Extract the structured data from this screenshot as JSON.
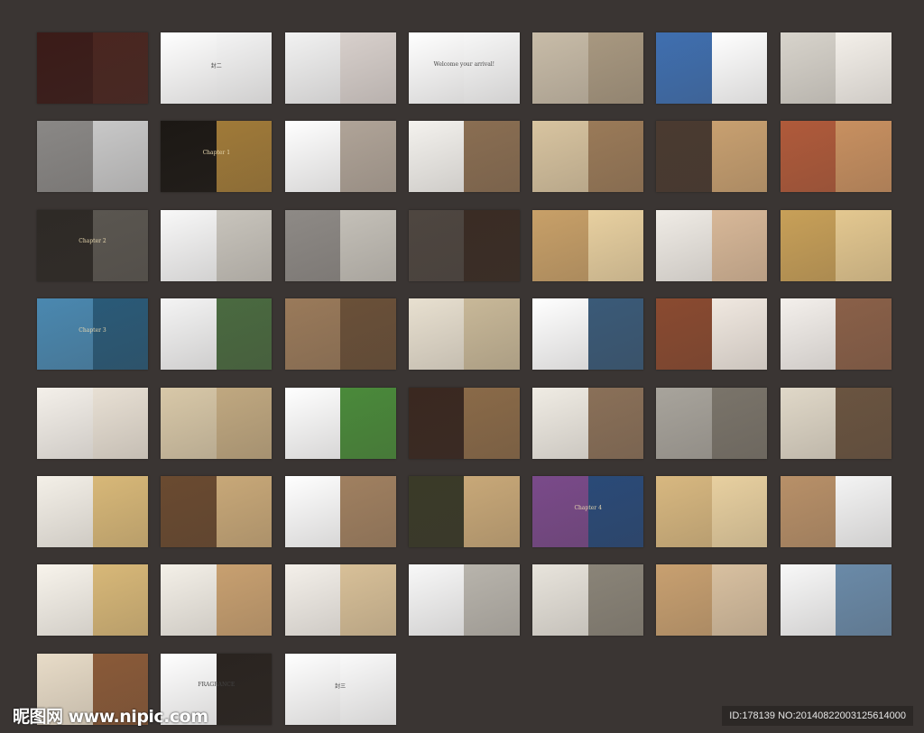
{
  "watermark": "昵图网 www.nipic.com",
  "image_id": "ID:178139 NO:20140822003125614000",
  "thumbnails": [
    {
      "l": "#3b1b18",
      "r": "#4a2620"
    },
    {
      "l": "#ffffff",
      "r": "#f4f4f4",
      "text": "封二"
    },
    {
      "l": "#f2f2f2",
      "r": "#d8d0cc"
    },
    {
      "l": "#ffffff",
      "r": "#f7f7f7",
      "text": "Welcome your arrival!"
    },
    {
      "l": "#c8bca8",
      "r": "#a89880"
    },
    {
      "l": "#3f6fb0",
      "r": "#ffffff"
    },
    {
      "l": "#d8d4cc",
      "r": "#f4f0ea"
    },
    {
      "l": "#8a8886",
      "r": "#c8c8c8"
    },
    {
      "l": "#1c1814",
      "r": "#a07a38",
      "text": "Chapter 1",
      "light": true
    },
    {
      "l": "#ffffff",
      "r": "#b0a498"
    },
    {
      "l": "#f4f2ee",
      "r": "#8a6e52"
    },
    {
      "l": "#d8c4a0",
      "r": "#9a7a58"
    },
    {
      "l": "#4a3a30",
      "r": "#c8a070"
    },
    {
      "l": "#b05a3a",
      "r": "#c89060"
    },
    {
      "l": "#2e2a26",
      "r": "#5a5650",
      "text": "Chapter 2",
      "light": true
    },
    {
      "l": "#f8f8f8",
      "r": "#c8c4bc"
    },
    {
      "l": "#8e8a86",
      "r": "#c4c0b8"
    },
    {
      "l": "#4e4640",
      "r": "#3a2c24"
    },
    {
      "l": "#c8a068",
      "r": "#e8d0a0"
    },
    {
      "l": "#f0ece6",
      "r": "#d8b898"
    },
    {
      "l": "#c8a058",
      "r": "#e4c890"
    },
    {
      "l": "#4a88b0",
      "r": "#2a5a78",
      "text": "Chapter 3",
      "light": true
    },
    {
      "l": "#f4f4f4",
      "r": "#4a6a40"
    },
    {
      "l": "#9a7a5a",
      "r": "#6a5038"
    },
    {
      "l": "#e8e0d0",
      "r": "#c8b898"
    },
    {
      "l": "#ffffff",
      "r": "#3a5a78"
    },
    {
      "l": "#8a4a30",
      "r": "#f0e8e0"
    },
    {
      "l": "#f4f0ec",
      "r": "#8a6048"
    },
    {
      "l": "#f4f0ea",
      "r": "#e8e0d4"
    },
    {
      "l": "#d8c8a8",
      "r": "#c0a880"
    },
    {
      "l": "#ffffff",
      "r": "#4a8a3a"
    },
    {
      "l": "#3a2820",
      "r": "#8a6a48"
    },
    {
      "l": "#f0ece4",
      "r": "#8a7058"
    },
    {
      "l": "#a8a49c",
      "r": "#7a746a"
    },
    {
      "l": "#e0d8c8",
      "r": "#6a5440"
    },
    {
      "l": "#f4f0e8",
      "r": "#d8b878"
    },
    {
      "l": "#6a4a30",
      "r": "#c8a878"
    },
    {
      "l": "#ffffff",
      "r": "#a08060"
    },
    {
      "l": "#3a3a28",
      "r": "#c8a878"
    },
    {
      "l": "#7a4a8a",
      "r": "#2a4a78",
      "text": "Chapter 4",
      "light": true
    },
    {
      "l": "#d8b880",
      "r": "#e8d0a0"
    },
    {
      "l": "#b89068",
      "r": "#f4f4f4"
    },
    {
      "l": "#f8f4ec",
      "r": "#d8b878"
    },
    {
      "l": "#f4f0e8",
      "r": "#c8a070"
    },
    {
      "l": "#f4f0ea",
      "r": "#d8c098"
    },
    {
      "l": "#f8f8f8",
      "r": "#b8b4ac"
    },
    {
      "l": "#e8e4dc",
      "r": "#8a8478"
    },
    {
      "l": "#c8a070",
      "r": "#d8c0a0"
    },
    {
      "l": "#f8f8f8",
      "r": "#6a8aa8"
    },
    {
      "l": "#e8dcc8",
      "r": "#8a5a38"
    },
    {
      "l": "#ffffff",
      "r": "#2a2420",
      "text": "FRAGRANCE"
    },
    {
      "l": "#ffffff",
      "r": "#fafafa",
      "text": "封三"
    }
  ]
}
